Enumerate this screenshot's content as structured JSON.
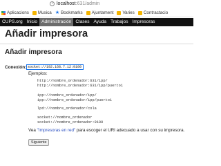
{
  "browser": {
    "url_host": "localhost",
    "url_path": ":631/admin"
  },
  "bookmarks": [
    {
      "label": "Aplicacions",
      "icon": "apps-grid-icon"
    },
    {
      "label": "Musica",
      "icon": "folder-icon"
    },
    {
      "label": "Bookmarks",
      "icon": "star-icon"
    },
    {
      "label": "Ajuntament",
      "icon": "folder-icon"
    },
    {
      "label": "Varies",
      "icon": "folder-icon"
    },
    {
      "label": "Contractacio",
      "icon": "folder-icon"
    }
  ],
  "nav": {
    "items": [
      "CUPS.org",
      "Inicio",
      "Administración",
      "Clases",
      "Ayuda",
      "Trabajos",
      "Impresoras"
    ],
    "active": "Administración"
  },
  "page": {
    "title": "Añadir impresora",
    "section_title": "Añadir impresora",
    "connection_label": "Conexión:",
    "connection_value": "socket://192.168.7.12:9100",
    "examples_label": "Ejemplos:",
    "examples": [
      "http://nombre_ordenador:631/ipp/",
      "http://nombre_ordenador:631/ipp/puerto1",
      "ipp://nombre_ordenador/ipp/",
      "ipp://nombre_ordenador/ipp/puerto1",
      "lpd://nombre_ordenador/cola",
      "socket://nombre_ordenador",
      "socket://nombre_ordenador:9100"
    ],
    "help_prefix": "Vea ",
    "help_link": "\"Impresoras en red\"",
    "help_suffix": " para escoger el URI adecuado a usar con su impresora.",
    "next_button": "Siguiente"
  }
}
